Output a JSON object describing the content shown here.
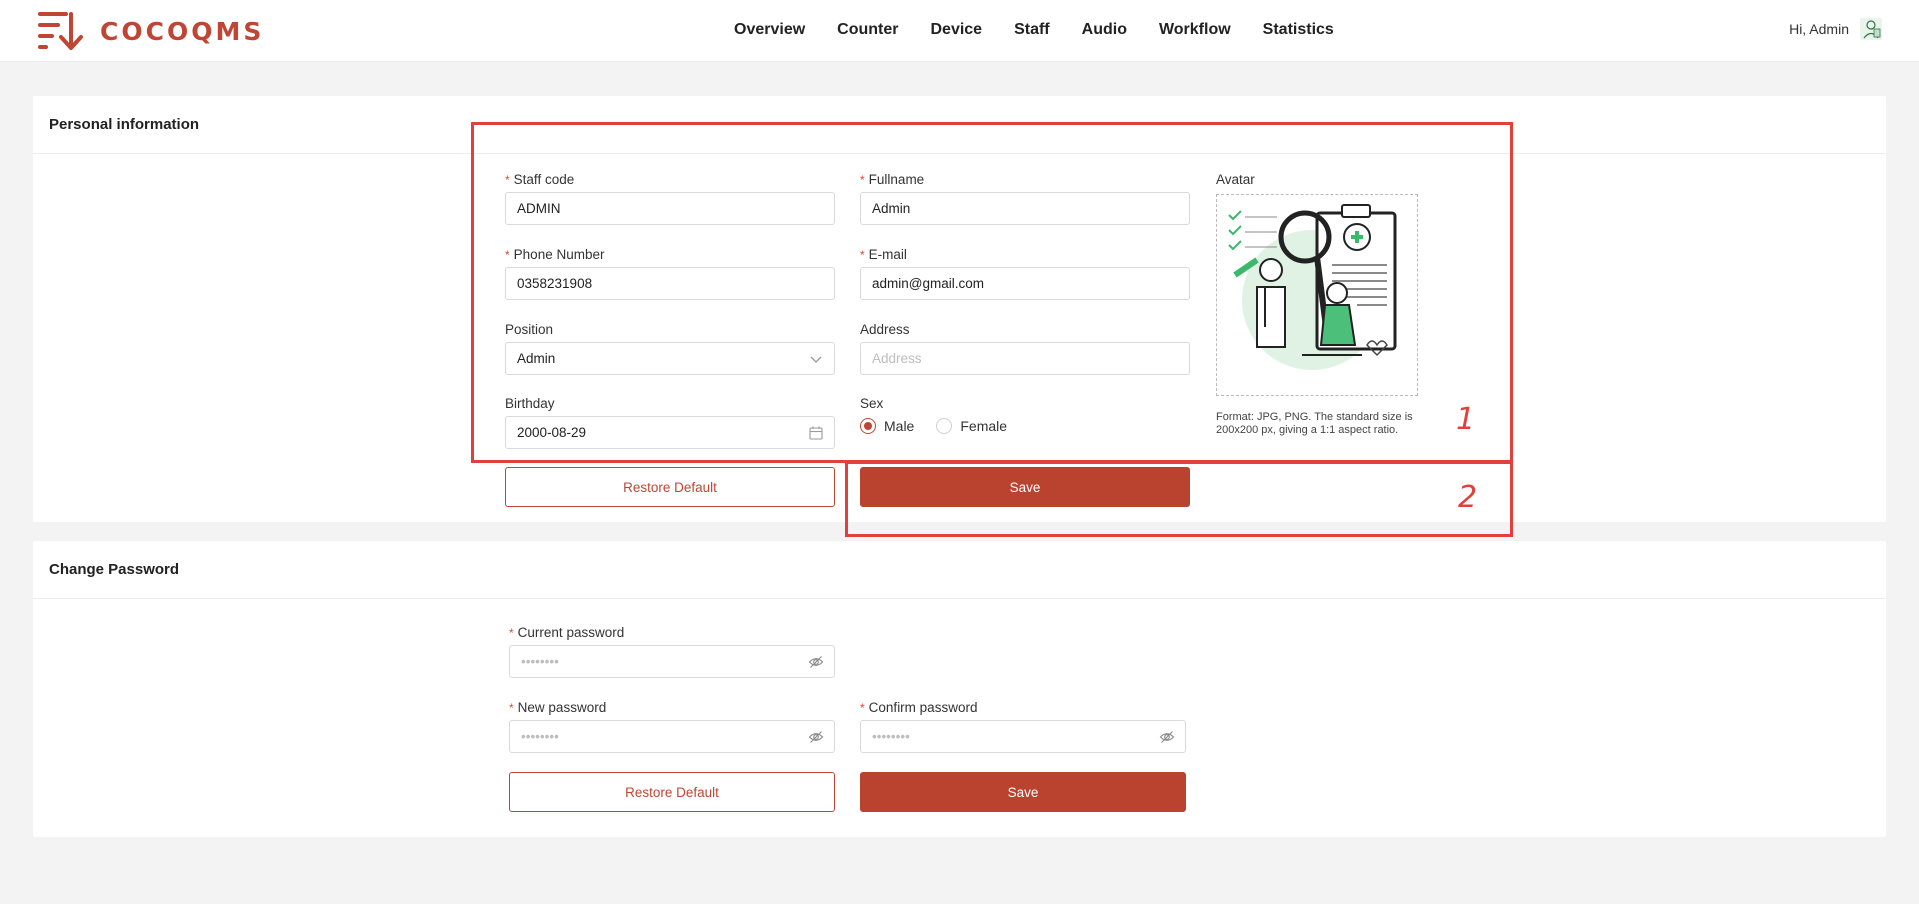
{
  "brand": {
    "name": "COCOQMS",
    "accent": "#bf4535"
  },
  "nav": [
    "Overview",
    "Counter",
    "Device",
    "Staff",
    "Audio",
    "Workflow",
    "Statistics"
  ],
  "user": {
    "greeting": "Hi, Admin"
  },
  "personal": {
    "title": "Personal information",
    "staff_code": {
      "label": "Staff code",
      "value": "ADMIN"
    },
    "fullname": {
      "label": "Fullname",
      "value": "Admin"
    },
    "phone": {
      "label": "Phone Number",
      "value": "0358231908"
    },
    "email": {
      "label": "E-mail",
      "value": "admin@gmail.com"
    },
    "position": {
      "label": "Position",
      "value": "Admin"
    },
    "address": {
      "label": "Address",
      "placeholder": "Address"
    },
    "birthday": {
      "label": "Birthday",
      "value": "2000-08-29"
    },
    "sex": {
      "label": "Sex",
      "options": [
        "Male",
        "Female"
      ],
      "selected": "Male"
    },
    "avatar": {
      "label": "Avatar",
      "hint": "Format: JPG, PNG. The standard size is 200x200 px, giving a 1:1 aspect ratio."
    },
    "restore_label": "Restore Default",
    "save_label": "Save"
  },
  "password": {
    "title": "Change Password",
    "current": {
      "label": "Current password",
      "placeholder": "••••••••"
    },
    "new": {
      "label": "New password",
      "placeholder": "••••••••"
    },
    "confirm": {
      "label": "Confirm password",
      "placeholder": "••••••••"
    },
    "restore_label": "Restore Default",
    "save_label": "Save"
  },
  "annotations": [
    "1",
    "2"
  ]
}
